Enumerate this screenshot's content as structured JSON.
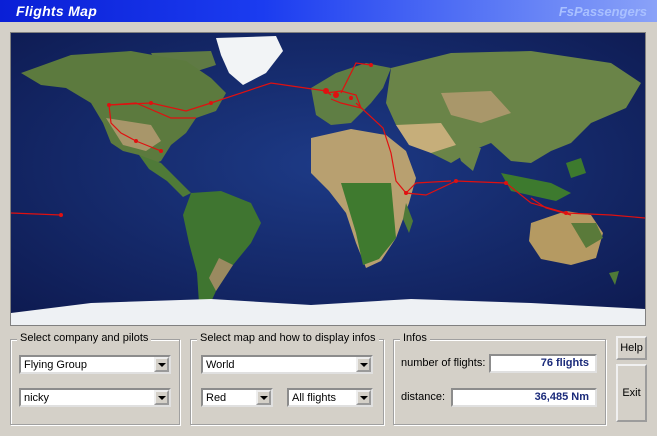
{
  "window": {
    "title": "Flights Map",
    "brand": "FsPassengers"
  },
  "company_group": {
    "legend": "Select company and pilots",
    "company": "Flying Group",
    "pilot": "nicky"
  },
  "map_group": {
    "legend": "Select map and how to display infos",
    "map": "World",
    "color": "Red",
    "filter": "All flights"
  },
  "infos_group": {
    "legend": "Infos",
    "flights_label": "number of flights:",
    "flights_value": "76 flights",
    "distance_label": "distance:",
    "distance_value": "36,485 Nm"
  },
  "buttons": {
    "help": "Help",
    "exit": "Exit"
  },
  "colors": {
    "route": "#e01010",
    "ocean": "#13286b",
    "title_bar": "#0a1fd6"
  }
}
